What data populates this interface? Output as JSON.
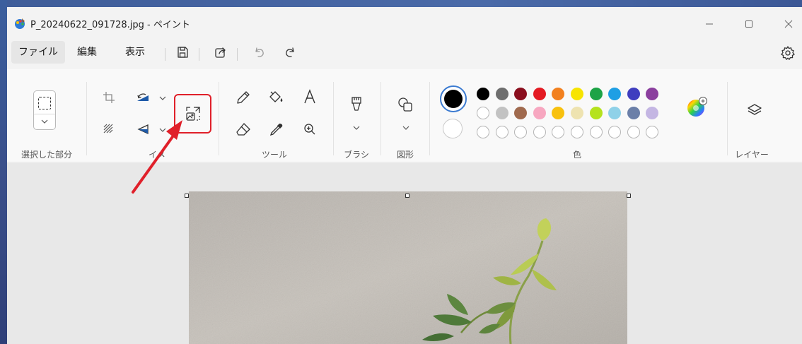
{
  "window": {
    "title": "P_20240622_091728.jpg - ペイント",
    "controls": [
      "minimize-icon",
      "maximize-icon",
      "close-icon"
    ]
  },
  "menu": {
    "file": "ファイル",
    "edit": "編集",
    "view": "表示",
    "quick_actions": [
      "save-icon",
      "share-icon",
      "undo-icon",
      "redo-icon"
    ]
  },
  "ribbon": {
    "groups": {
      "selection": "選択した部分",
      "image": "イメ",
      "tools": "ツール",
      "brushes": "ブラシ",
      "shapes": "図形",
      "colors": "色",
      "layers": "レイヤー"
    },
    "image_tools": [
      "crop-icon",
      "rotate-icon",
      "flip-icon",
      "remove-background-icon",
      "resize-image-icon"
    ],
    "tools": [
      "pencil-icon",
      "fill-icon",
      "text-icon",
      "eraser-icon",
      "color-picker-icon",
      "magnifier-icon"
    ],
    "highlighted_tool": "resize-image-icon"
  },
  "colors": {
    "primary": "#000000",
    "secondary": "#ffffff",
    "palette_row1": [
      "#000000",
      "#6e6e6e",
      "#8b0f1e",
      "#e41b23",
      "#f2801f",
      "#f7e400",
      "#1da346",
      "#1f9fe4",
      "#3f3ebf",
      "#8b3f9e"
    ],
    "palette_row2": [
      "#ffffff",
      "#c2c2c2",
      "#a06a4e",
      "#f7a7c0",
      "#f8c10e",
      "#eee3b0",
      "#b5e21d",
      "#8fd1e8",
      "#6b7fa8",
      "#c4b6e3"
    ],
    "annotation_color": "#e0202a",
    "accent": "#3c7bd1"
  }
}
